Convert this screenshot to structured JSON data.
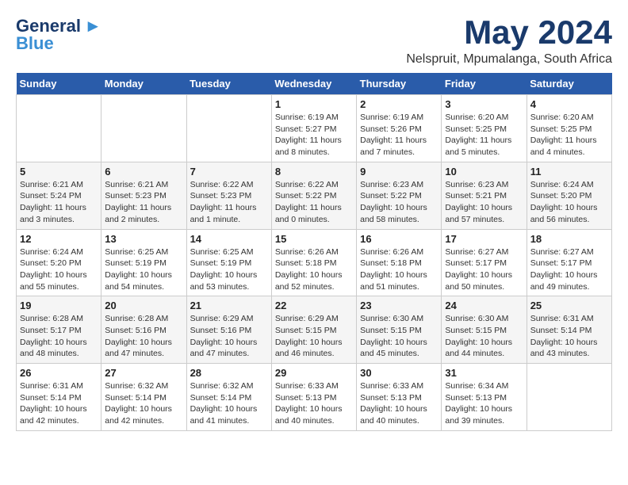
{
  "header": {
    "logo_general": "General",
    "logo_blue": "Blue",
    "month_title": "May 2024",
    "subtitle": "Nelspruit, Mpumalanga, South Africa"
  },
  "weekdays": [
    "Sunday",
    "Monday",
    "Tuesday",
    "Wednesday",
    "Thursday",
    "Friday",
    "Saturday"
  ],
  "weeks": [
    [
      {
        "day": "",
        "info": ""
      },
      {
        "day": "",
        "info": ""
      },
      {
        "day": "",
        "info": ""
      },
      {
        "day": "1",
        "info": "Sunrise: 6:19 AM\nSunset: 5:27 PM\nDaylight: 11 hours\nand 8 minutes."
      },
      {
        "day": "2",
        "info": "Sunrise: 6:19 AM\nSunset: 5:26 PM\nDaylight: 11 hours\nand 7 minutes."
      },
      {
        "day": "3",
        "info": "Sunrise: 6:20 AM\nSunset: 5:25 PM\nDaylight: 11 hours\nand 5 minutes."
      },
      {
        "day": "4",
        "info": "Sunrise: 6:20 AM\nSunset: 5:25 PM\nDaylight: 11 hours\nand 4 minutes."
      }
    ],
    [
      {
        "day": "5",
        "info": "Sunrise: 6:21 AM\nSunset: 5:24 PM\nDaylight: 11 hours\nand 3 minutes."
      },
      {
        "day": "6",
        "info": "Sunrise: 6:21 AM\nSunset: 5:23 PM\nDaylight: 11 hours\nand 2 minutes."
      },
      {
        "day": "7",
        "info": "Sunrise: 6:22 AM\nSunset: 5:23 PM\nDaylight: 11 hours\nand 1 minute."
      },
      {
        "day": "8",
        "info": "Sunrise: 6:22 AM\nSunset: 5:22 PM\nDaylight: 11 hours\nand 0 minutes."
      },
      {
        "day": "9",
        "info": "Sunrise: 6:23 AM\nSunset: 5:22 PM\nDaylight: 10 hours\nand 58 minutes."
      },
      {
        "day": "10",
        "info": "Sunrise: 6:23 AM\nSunset: 5:21 PM\nDaylight: 10 hours\nand 57 minutes."
      },
      {
        "day": "11",
        "info": "Sunrise: 6:24 AM\nSunset: 5:20 PM\nDaylight: 10 hours\nand 56 minutes."
      }
    ],
    [
      {
        "day": "12",
        "info": "Sunrise: 6:24 AM\nSunset: 5:20 PM\nDaylight: 10 hours\nand 55 minutes."
      },
      {
        "day": "13",
        "info": "Sunrise: 6:25 AM\nSunset: 5:19 PM\nDaylight: 10 hours\nand 54 minutes."
      },
      {
        "day": "14",
        "info": "Sunrise: 6:25 AM\nSunset: 5:19 PM\nDaylight: 10 hours\nand 53 minutes."
      },
      {
        "day": "15",
        "info": "Sunrise: 6:26 AM\nSunset: 5:18 PM\nDaylight: 10 hours\nand 52 minutes."
      },
      {
        "day": "16",
        "info": "Sunrise: 6:26 AM\nSunset: 5:18 PM\nDaylight: 10 hours\nand 51 minutes."
      },
      {
        "day": "17",
        "info": "Sunrise: 6:27 AM\nSunset: 5:17 PM\nDaylight: 10 hours\nand 50 minutes."
      },
      {
        "day": "18",
        "info": "Sunrise: 6:27 AM\nSunset: 5:17 PM\nDaylight: 10 hours\nand 49 minutes."
      }
    ],
    [
      {
        "day": "19",
        "info": "Sunrise: 6:28 AM\nSunset: 5:17 PM\nDaylight: 10 hours\nand 48 minutes."
      },
      {
        "day": "20",
        "info": "Sunrise: 6:28 AM\nSunset: 5:16 PM\nDaylight: 10 hours\nand 47 minutes."
      },
      {
        "day": "21",
        "info": "Sunrise: 6:29 AM\nSunset: 5:16 PM\nDaylight: 10 hours\nand 47 minutes."
      },
      {
        "day": "22",
        "info": "Sunrise: 6:29 AM\nSunset: 5:15 PM\nDaylight: 10 hours\nand 46 minutes."
      },
      {
        "day": "23",
        "info": "Sunrise: 6:30 AM\nSunset: 5:15 PM\nDaylight: 10 hours\nand 45 minutes."
      },
      {
        "day": "24",
        "info": "Sunrise: 6:30 AM\nSunset: 5:15 PM\nDaylight: 10 hours\nand 44 minutes."
      },
      {
        "day": "25",
        "info": "Sunrise: 6:31 AM\nSunset: 5:14 PM\nDaylight: 10 hours\nand 43 minutes."
      }
    ],
    [
      {
        "day": "26",
        "info": "Sunrise: 6:31 AM\nSunset: 5:14 PM\nDaylight: 10 hours\nand 42 minutes."
      },
      {
        "day": "27",
        "info": "Sunrise: 6:32 AM\nSunset: 5:14 PM\nDaylight: 10 hours\nand 42 minutes."
      },
      {
        "day": "28",
        "info": "Sunrise: 6:32 AM\nSunset: 5:14 PM\nDaylight: 10 hours\nand 41 minutes."
      },
      {
        "day": "29",
        "info": "Sunrise: 6:33 AM\nSunset: 5:13 PM\nDaylight: 10 hours\nand 40 minutes."
      },
      {
        "day": "30",
        "info": "Sunrise: 6:33 AM\nSunset: 5:13 PM\nDaylight: 10 hours\nand 40 minutes."
      },
      {
        "day": "31",
        "info": "Sunrise: 6:34 AM\nSunset: 5:13 PM\nDaylight: 10 hours\nand 39 minutes."
      },
      {
        "day": "",
        "info": ""
      }
    ]
  ]
}
